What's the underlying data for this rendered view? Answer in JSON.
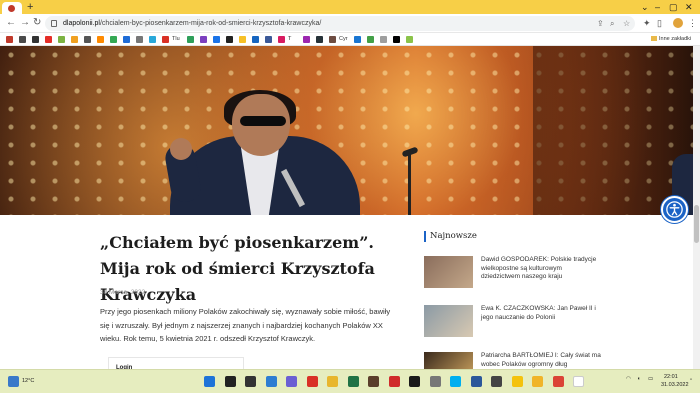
{
  "browser": {
    "url_domain": "dlapolonii.pl",
    "url_path": "/chcialem-byc-piosenkarzem-mija-rok-od-smierci-krzysztofa-krawczyka/",
    "new_tab_symbol": "+",
    "other_bookmarks_label": "Inne zakładki",
    "bookmarks": [
      {
        "icon": "rakuten-bookmark-icon",
        "color": "#c0392b"
      },
      {
        "icon": "grid-bookmark-icon",
        "color": "#4a4a4a"
      },
      {
        "icon": "mail-bookmark-icon",
        "color": "#333333"
      },
      {
        "icon": "youtube-bookmark-icon",
        "color": "#e52d27"
      },
      {
        "icon": "android-bookmark-icon",
        "color": "#7cb342"
      },
      {
        "icon": "shield-bookmark-icon",
        "color": "#f0a020"
      },
      {
        "icon": "wikipedia-bookmark-icon",
        "color": "#555555"
      },
      {
        "icon": "orange-bookmark-icon",
        "color": "#ff8a00"
      },
      {
        "icon": "maps-bookmark-icon",
        "color": "#34a853"
      },
      {
        "icon": "blue-bookmark-icon",
        "color": "#1e6bd6"
      },
      {
        "icon": "plus-bookmark-icon",
        "color": "#777777"
      },
      {
        "icon": "cyan-bookmark-icon",
        "color": "#29a8d9"
      },
      {
        "icon": "red-square-bookmark-icon",
        "color": "#d93025"
      },
      {
        "icon": "green-bookmark-icon",
        "color": "#2e9f5a"
      },
      {
        "icon": "purple-bookmark-icon",
        "color": "#7b3fbf"
      },
      {
        "icon": "star-bookmark-icon",
        "color": "#1a73e8"
      },
      {
        "icon": "tiktok-bookmark-icon",
        "color": "#222222"
      },
      {
        "icon": "yellow-bookmark-icon",
        "color": "#f6c026"
      },
      {
        "icon": "calendar-bookmark-icon",
        "color": "#1565c0"
      },
      {
        "icon": "news-bookmark-icon",
        "color": "#3b5998"
      },
      {
        "icon": "pink-bookmark-icon",
        "color": "#d81b60"
      },
      {
        "icon": "music-bookmark-icon",
        "color": "#9c27b0"
      },
      {
        "icon": "dark-bookmark-icon",
        "color": "#263238"
      },
      {
        "icon": "mic-bookmark-icon",
        "color": "#6d4c41"
      },
      {
        "icon": "t-bookmark-icon",
        "color": "#1976d2"
      },
      {
        "icon": "phone-bookmark-icon",
        "color": "#43a047"
      },
      {
        "icon": "gray-bookmark-icon",
        "color": "#9e9e9e"
      },
      {
        "icon": "black-square-bookmark-icon",
        "color": "#000000"
      },
      {
        "icon": "arrow-bookmark-icon",
        "color": "#8bc34a"
      }
    ],
    "bookmark_texts": [
      {
        "text": "Tlu",
        "after_index": 12
      },
      {
        "text": "T",
        "after_index": 20
      },
      {
        "text": "Cyr",
        "after_index": 23
      }
    ]
  },
  "article": {
    "title": "„Chciałem być piosenkarzem”. Mija rok od śmierci Krzysztofa Krawczyka",
    "date": "30 Marca, 2022",
    "lead": "Przy jego piosenkach miliony Polaków zakochiwały się, wyznawały sobie miłość, bawiły się i wzruszały. Był jednym z najszerzej znanych i najbardziej kochanych Polaków XX wieku. Rok temu, 5 kwietnia 2021 r. odszedł Krzysztof Krawczyk.",
    "login_label": "Login"
  },
  "sidebar": {
    "title": "Najnowsze",
    "items": [
      {
        "text": "Dawid GOSPODAREK: Polskie tradycje wielkopostne są kulturowym dziedzictwem naszego kraju",
        "thumb": [
          "#8a6d5c",
          "#c4a88a"
        ]
      },
      {
        "text": "Ewa K. CZACZKOWSKA: Jan Paweł II i jego nauczanie do Polonii",
        "thumb": [
          "#8b9aa5",
          "#d8c9b2"
        ]
      },
      {
        "text": "Patriarcha BARTŁOMIEJ I: Cały świat ma wobec Polaków ogromny dług wdzięczności",
        "thumb": [
          "#3a2a1c",
          "#b89256"
        ]
      }
    ]
  },
  "taskbar": {
    "weather_temp": "12°C",
    "time": "22:01",
    "date": "31.03.2022",
    "apps": [
      {
        "icon": "windows-start-icon",
        "color": "#1e73d8"
      },
      {
        "icon": "search-icon",
        "color": "#222222"
      },
      {
        "icon": "task-view-icon",
        "color": "#333333"
      },
      {
        "icon": "widgets-icon",
        "color": "#2d7dd2"
      },
      {
        "icon": "teams-chat-icon",
        "color": "#6b5fd3"
      },
      {
        "icon": "record-icon",
        "color": "#d93025"
      },
      {
        "icon": "explorer-icon",
        "color": "#e8b62d"
      },
      {
        "icon": "files-icon",
        "color": "#207245"
      },
      {
        "icon": "media-icon",
        "color": "#5a3e2b"
      },
      {
        "icon": "headphones-icon",
        "color": "#d02b2b"
      },
      {
        "icon": "tv-icon",
        "color": "#1a1a1a"
      },
      {
        "icon": "settings-icon",
        "color": "#777777"
      },
      {
        "icon": "skype-icon",
        "color": "#00aff0"
      },
      {
        "icon": "word-icon",
        "color": "#2b579a"
      },
      {
        "icon": "calc-icon",
        "color": "#444444"
      },
      {
        "icon": "notes-icon",
        "color": "#f4c20d"
      },
      {
        "icon": "folder-icon",
        "color": "#f0b429"
      },
      {
        "icon": "chrome-icon",
        "color": "#db4437"
      },
      {
        "icon": "blank-icon",
        "color": "#ffffff"
      }
    ]
  }
}
